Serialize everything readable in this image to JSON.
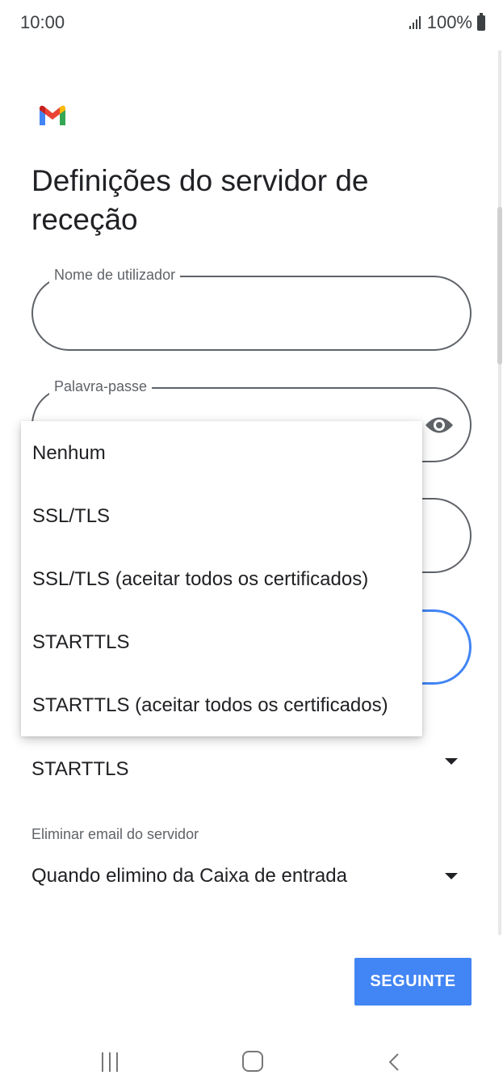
{
  "status_bar": {
    "time": "10:00",
    "battery": "100%",
    "icons": [
      "signal-icon",
      "battery-icon"
    ]
  },
  "page": {
    "title": "Definições do servidor de receção"
  },
  "fields": {
    "username": {
      "label": "Nome de utilizador",
      "value": ""
    },
    "password": {
      "label": "Palavra-passe",
      "value": "",
      "icon": "eye-icon"
    }
  },
  "security_select": {
    "selected": "STARTTLS"
  },
  "delete_select": {
    "label": "Eliminar email do servidor",
    "selected": "Quando elimino da Caixa de entrada"
  },
  "security_menu": {
    "items": [
      {
        "label": "Nenhum"
      },
      {
        "label": "SSL/TLS"
      },
      {
        "label": "SSL/TLS (aceitar todos os certificados)"
      },
      {
        "label": "STARTTLS"
      },
      {
        "label": "STARTTLS (aceitar todos os certificados)"
      }
    ]
  },
  "actions": {
    "next_label": "SEGUINTE"
  },
  "colors": {
    "accent": "#4285f4",
    "text": "#202124",
    "secondary": "#5f6368"
  }
}
